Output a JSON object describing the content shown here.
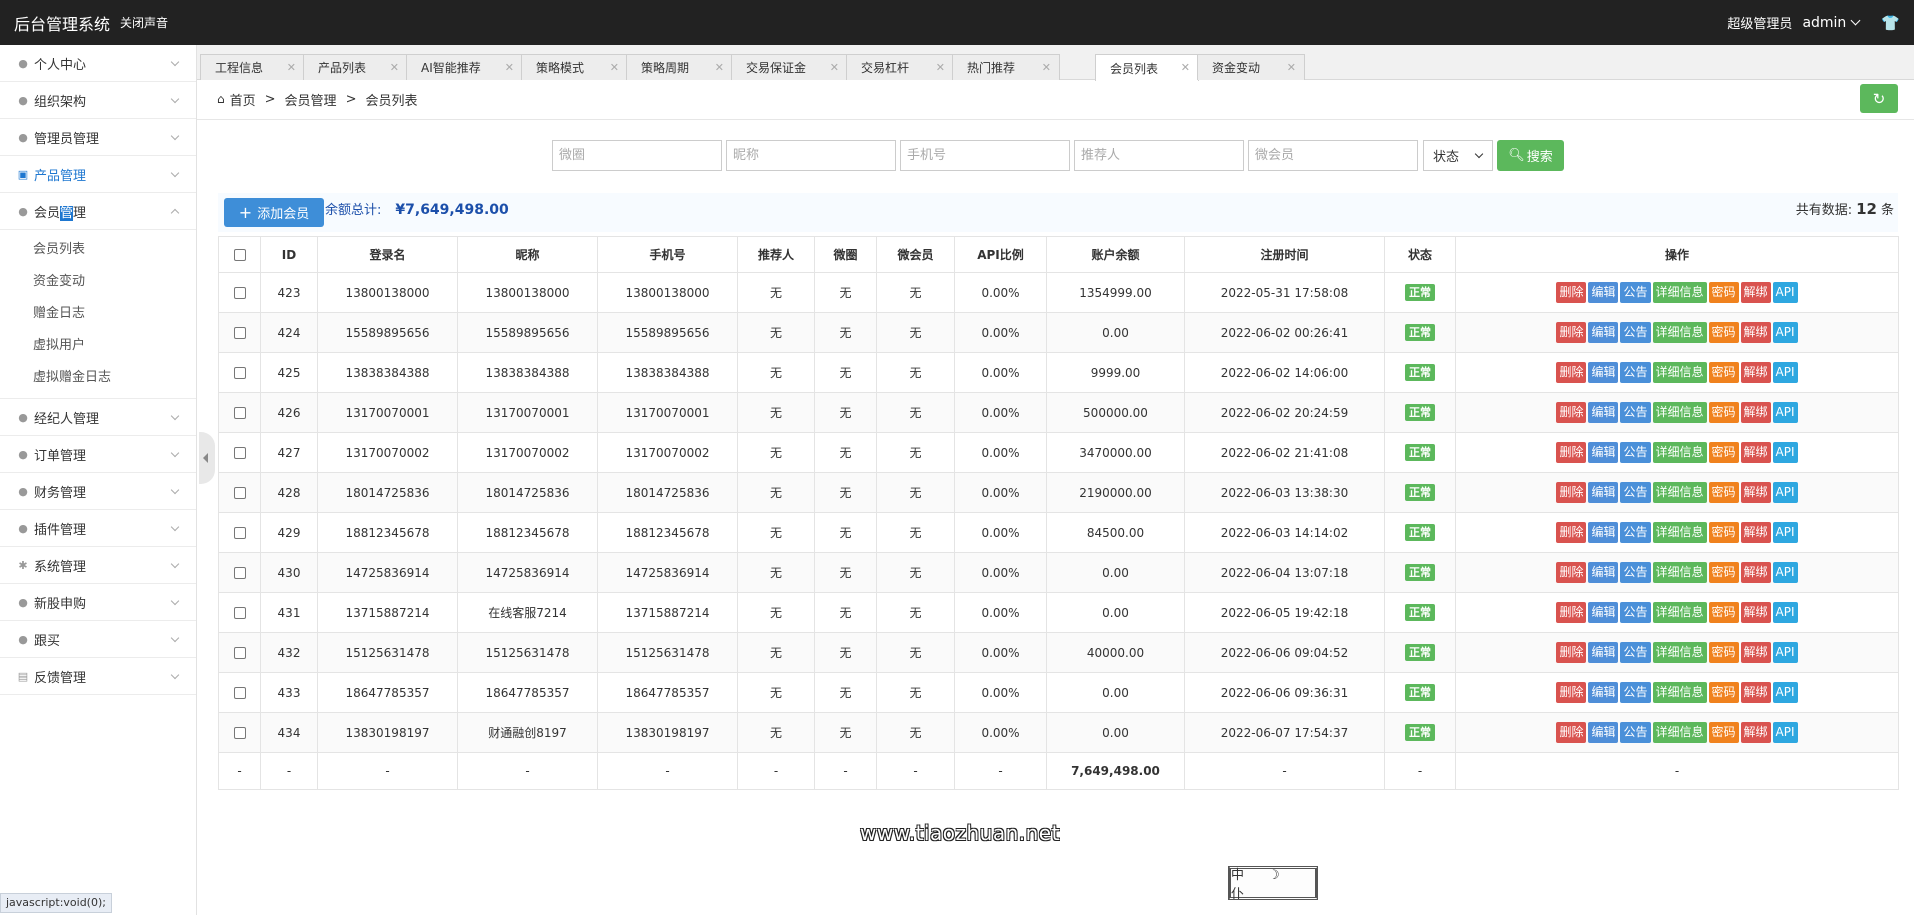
{
  "topbar": {
    "title": "后台管理系统",
    "mute_label": "关闭声音",
    "role": "超级管理员",
    "username": "admin"
  },
  "sidebar": {
    "items": [
      {
        "label": "个人中心",
        "icon": "user-icon"
      },
      {
        "label": "组织架构",
        "icon": "org-icon"
      },
      {
        "label": "管理员管理",
        "icon": "admin-icon"
      },
      {
        "label": "产品管理",
        "icon": "product-icon"
      },
      {
        "label_a": "会员",
        "label_b": "管",
        "label_c": "理",
        "icon": "member-icon"
      },
      {
        "label": "经纪人管理",
        "icon": "broker-icon"
      },
      {
        "label": "订单管理",
        "icon": "order-icon"
      },
      {
        "label": "财务管理",
        "icon": "finance-icon"
      },
      {
        "label": "插件管理",
        "icon": "plugin-icon"
      },
      {
        "label": "系统管理",
        "icon": "system-icon"
      },
      {
        "label": "新股申购",
        "icon": "ipo-icon"
      },
      {
        "label": "跟买",
        "icon": "follow-icon"
      },
      {
        "label": "反馈管理",
        "icon": "feedback-icon"
      }
    ],
    "sub_items": [
      "会员列表",
      "资金变动",
      "赠金日志",
      "虚拟用户",
      "虚拟赠金日志"
    ],
    "status_tip": "javascript:void(0);"
  },
  "tabs": [
    "工程信息",
    "产品列表",
    "AI智能推荐",
    "策略模式",
    "策略周期",
    "交易保证金",
    "交易杠杆",
    "热门推荐",
    "会员列表",
    "资金变动"
  ],
  "breadcrumb": {
    "home": "首页",
    "level1": "会员管理",
    "level2": "会员列表",
    "sep": ">"
  },
  "search": {
    "placeholders": [
      "微圈",
      "昵称",
      "手机号",
      "推荐人",
      "微会员"
    ],
    "status_select": "状态",
    "button": "搜索"
  },
  "summary": {
    "add_button": "添加会员",
    "total_label": "余额总计:",
    "total_value": "¥7,649,498.00",
    "count_label": "共有数据:",
    "count_value": "12",
    "count_unit": "条"
  },
  "table": {
    "headers": [
      "ID",
      "登录名",
      "昵称",
      "手机号",
      "推荐人",
      "微圈",
      "微会员",
      "API比例",
      "账户余额",
      "注册时间",
      "状态",
      "操作"
    ],
    "rows": [
      {
        "id": "423",
        "login": "13800138000",
        "nick": "13800138000",
        "phone": "13800138000",
        "ref": "无",
        "circle": "无",
        "vm": "无",
        "api": "0.00%",
        "balance": "1354999.00",
        "time": "2022-05-31 17:58:08",
        "status": "正常"
      },
      {
        "id": "424",
        "login": "15589895656",
        "nick": "15589895656",
        "phone": "15589895656",
        "ref": "无",
        "circle": "无",
        "vm": "无",
        "api": "0.00%",
        "balance": "0.00",
        "time": "2022-06-02 00:26:41",
        "status": "正常"
      },
      {
        "id": "425",
        "login": "13838384388",
        "nick": "13838384388",
        "phone": "13838384388",
        "ref": "无",
        "circle": "无",
        "vm": "无",
        "api": "0.00%",
        "balance": "9999.00",
        "time": "2022-06-02 14:06:00",
        "status": "正常"
      },
      {
        "id": "426",
        "login": "13170070001",
        "nick": "13170070001",
        "phone": "13170070001",
        "ref": "无",
        "circle": "无",
        "vm": "无",
        "api": "0.00%",
        "balance": "500000.00",
        "time": "2022-06-02 20:24:59",
        "status": "正常"
      },
      {
        "id": "427",
        "login": "13170070002",
        "nick": "13170070002",
        "phone": "13170070002",
        "ref": "无",
        "circle": "无",
        "vm": "无",
        "api": "0.00%",
        "balance": "3470000.00",
        "time": "2022-06-02 21:41:08",
        "status": "正常"
      },
      {
        "id": "428",
        "login": "18014725836",
        "nick": "18014725836",
        "phone": "18014725836",
        "ref": "无",
        "circle": "无",
        "vm": "无",
        "api": "0.00%",
        "balance": "2190000.00",
        "time": "2022-06-03 13:38:30",
        "status": "正常"
      },
      {
        "id": "429",
        "login": "18812345678",
        "nick": "18812345678",
        "phone": "18812345678",
        "ref": "无",
        "circle": "无",
        "vm": "无",
        "api": "0.00%",
        "balance": "84500.00",
        "time": "2022-06-03 14:14:02",
        "status": "正常"
      },
      {
        "id": "430",
        "login": "14725836914",
        "nick": "14725836914",
        "phone": "14725836914",
        "ref": "无",
        "circle": "无",
        "vm": "无",
        "api": "0.00%",
        "balance": "0.00",
        "time": "2022-06-04 13:07:18",
        "status": "正常"
      },
      {
        "id": "431",
        "login": "13715887214",
        "nick": "在线客服7214",
        "phone": "13715887214",
        "ref": "无",
        "circle": "无",
        "vm": "无",
        "api": "0.00%",
        "balance": "0.00",
        "time": "2022-06-05 19:42:18",
        "status": "正常"
      },
      {
        "id": "432",
        "login": "15125631478",
        "nick": "15125631478",
        "phone": "15125631478",
        "ref": "无",
        "circle": "无",
        "vm": "无",
        "api": "0.00%",
        "balance": "40000.00",
        "time": "2022-06-06 09:04:52",
        "status": "正常"
      },
      {
        "id": "433",
        "login": "18647785357",
        "nick": "18647785357",
        "phone": "18647785357",
        "ref": "无",
        "circle": "无",
        "vm": "无",
        "api": "0.00%",
        "balance": "0.00",
        "time": "2022-06-06 09:36:31",
        "status": "正常"
      },
      {
        "id": "434",
        "login": "13830198197",
        "nick": "财通融创8197",
        "phone": "13830198197",
        "ref": "无",
        "circle": "无",
        "vm": "无",
        "api": "0.00%",
        "balance": "0.00",
        "time": "2022-06-07 17:54:37",
        "status": "正常"
      }
    ],
    "actions": [
      "删除",
      "编辑",
      "公告",
      "详细信息",
      "密码",
      "解绑",
      "API"
    ],
    "footer": {
      "dash": "-",
      "total": "7,649,498.00"
    }
  },
  "watermark": {
    "text": "www.tiaozhuan.net",
    "seal": "中 ☽ 仆"
  },
  "colors": {
    "topbar": "#222222",
    "primary": "#3e8ed8",
    "success": "#5cb85c",
    "danger": "#d9534f",
    "warning": "#f0821e",
    "info": "#2ea7e0",
    "link_blue": "#1e77d0"
  }
}
